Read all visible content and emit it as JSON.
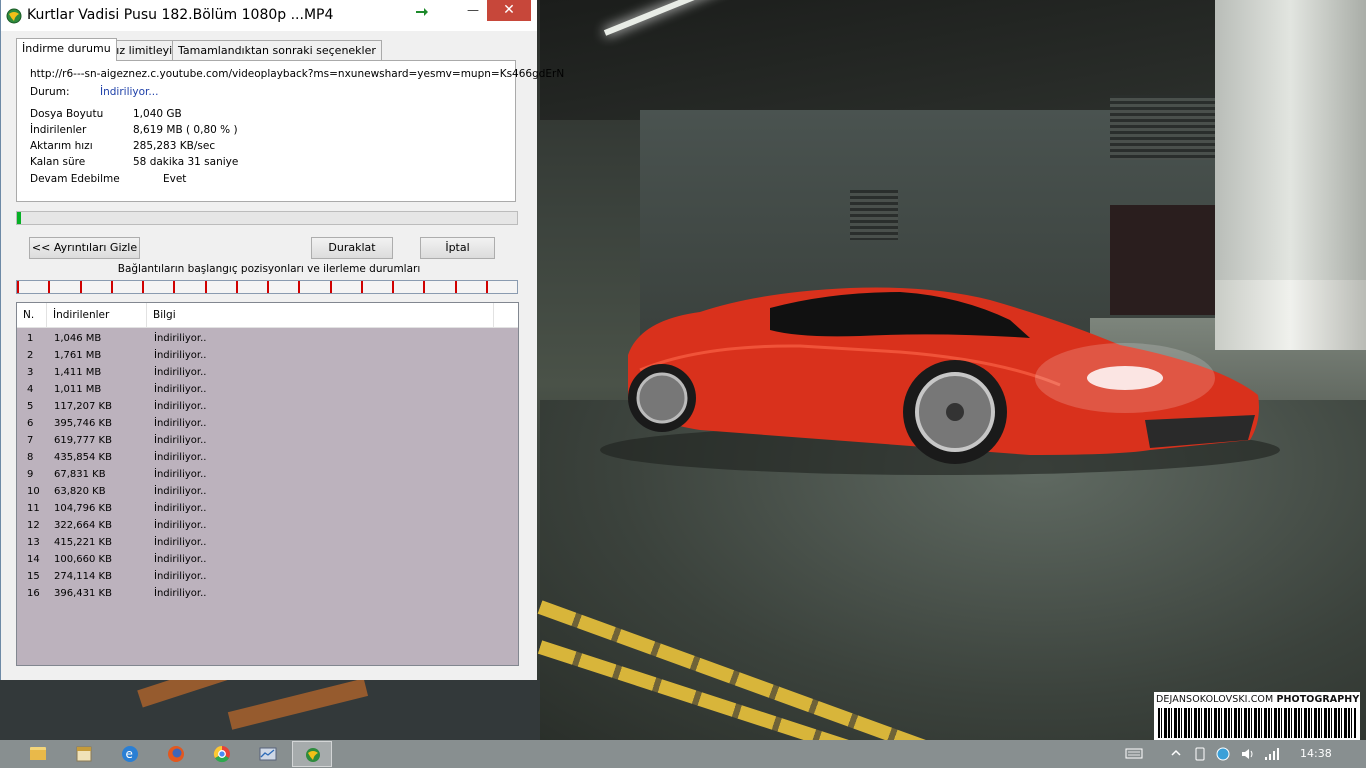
{
  "window": {
    "title": "Kurtlar Vadisi Pusu 182.Bölüm 1080p ...MP4",
    "close_glyph": "✕",
    "minimize_glyph": "—",
    "maximize_glyph": "☐",
    "icon": "idm-globe-icon"
  },
  "tabs": [
    {
      "label": "İndirme durumu",
      "active": true
    },
    {
      "label": "Hız limitleyici",
      "active": false
    },
    {
      "label": "Tamamlandıktan sonraki seçenekler",
      "active": false
    }
  ],
  "info": {
    "url": "http://r6---sn-aigeznez.c.youtube.com/videoplayback?ms=nxunewshard=yesmv=mupn=Ks466gdErN",
    "status_label": "Durum:",
    "status_value": "İndiriliyor...",
    "file_size_label": "Dosya Boyutu",
    "file_size_value": "1,040  GB",
    "downloaded_label": "İndirilenler",
    "downloaded_value": "8,619  MB  ( 0,80 % )",
    "rate_label": "Aktarım hızı",
    "rate_value": "285,283  KB/sec",
    "remaining_label": "Kalan süre",
    "remaining_value": "58 dakika 31 saniye",
    "resume_label": "Devam Edebilme",
    "resume_value": "Evet"
  },
  "progress": {
    "fraction": 0.008
  },
  "buttons": {
    "details": "<< Ayrıntıları Gizle",
    "pause": "Duraklat",
    "cancel": "İptal"
  },
  "connections": {
    "caption": "Bağlantıların başlangıç pozisyonları ve ilerleme durumları",
    "marker_color": "#d00000",
    "count": 16
  },
  "table": {
    "headers": {
      "n": "N.",
      "downloaded": "İndirilenler",
      "info": "Bilgi"
    },
    "rows": [
      {
        "n": "1",
        "downloaded": "1,046  MB",
        "info": "İndiriliyor.."
      },
      {
        "n": "2",
        "downloaded": "1,761  MB",
        "info": "İndiriliyor.."
      },
      {
        "n": "3",
        "downloaded": "1,411  MB",
        "info": "İndiriliyor.."
      },
      {
        "n": "4",
        "downloaded": "1,011  MB",
        "info": "İndiriliyor.."
      },
      {
        "n": "5",
        "downloaded": "117,207  KB",
        "info": "İndiriliyor.."
      },
      {
        "n": "6",
        "downloaded": "395,746  KB",
        "info": "İndiriliyor.."
      },
      {
        "n": "7",
        "downloaded": "619,777  KB",
        "info": "İndiriliyor.."
      },
      {
        "n": "8",
        "downloaded": "435,854  KB",
        "info": "İndiriliyor.."
      },
      {
        "n": "9",
        "downloaded": "67,831  KB",
        "info": "İndiriliyor.."
      },
      {
        "n": "10",
        "downloaded": "63,820  KB",
        "info": "İndiriliyor.."
      },
      {
        "n": "11",
        "downloaded": "104,796  KB",
        "info": "İndiriliyor.."
      },
      {
        "n": "12",
        "downloaded": "322,664  KB",
        "info": "İndiriliyor.."
      },
      {
        "n": "13",
        "downloaded": "415,221  KB",
        "info": "İndiriliyor.."
      },
      {
        "n": "14",
        "downloaded": "100,660  KB",
        "info": "İndiriliyor.."
      },
      {
        "n": "15",
        "downloaded": "274,114  KB",
        "info": "İndiriliyor.."
      },
      {
        "n": "16",
        "downloaded": "396,431  KB",
        "info": "İndiriliyor.."
      }
    ]
  },
  "desktop": {
    "watermark_name": "DEJANSOKOLOVSKI.COM",
    "watermark_word": "PHOTOGRAPHY"
  },
  "taskbar": {
    "apps": [
      "file-explorer-icon",
      "file-manager-icon",
      "internet-explorer-icon",
      "firefox-icon",
      "chrome-icon",
      "system-monitor-icon",
      "idm-icon"
    ],
    "clock": "14:38"
  }
}
